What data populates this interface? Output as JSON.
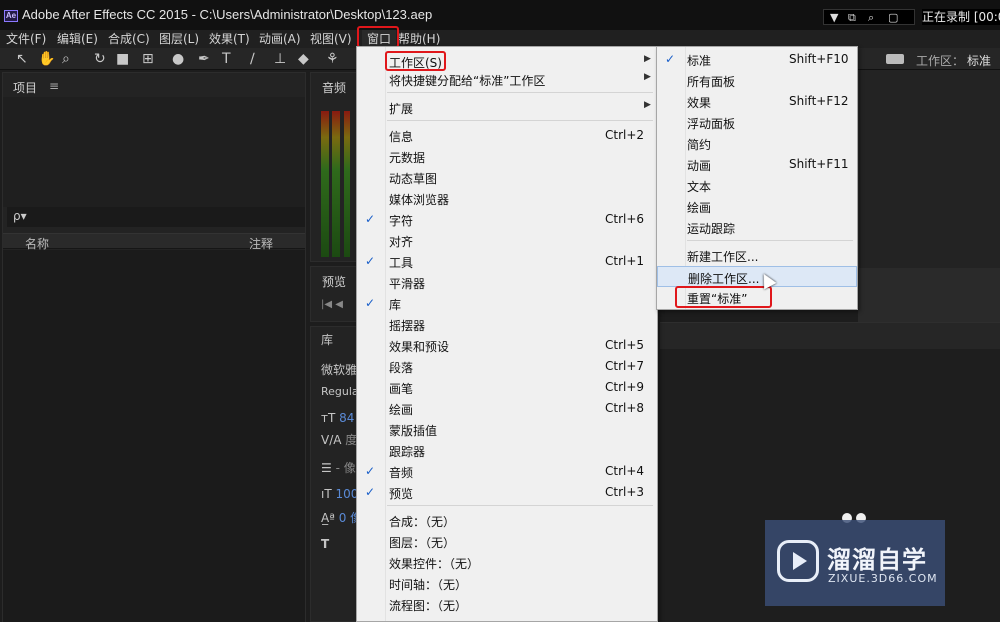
{
  "app": {
    "logo": "Ae",
    "title": "Adobe After Effects CC 2015 - C:\\Users\\Administrator\\Desktop\\123.aep",
    "recording_status": "正在录制 [00:04"
  },
  "menubar": {
    "items": [
      "文件(F)",
      "编辑(E)",
      "合成(C)",
      "图层(L)",
      "效果(T)",
      "动画(A)",
      "视图(V)",
      "窗口",
      "帮助(H)"
    ]
  },
  "toolbar": {
    "workspace_label": "工作区：",
    "workspace_value": "标准"
  },
  "panels": {
    "project_title": "项目",
    "project_menu_icon": "≡",
    "search_icon": "ρ▾",
    "col_name": "名称",
    "col_note": "注释",
    "audio_title": "音频",
    "preview_title": "预览",
    "library_title": "库",
    "char_font": "微软雅",
    "char_style": "Regula",
    "char_size": "84",
    "char_tracking": "度",
    "char_line": "- 像",
    "char_scale": "100",
    "char_baseline": "0 像"
  },
  "window_menu": {
    "items": [
      {
        "label": "工作区(S)",
        "shortcut": "",
        "checked": false,
        "submenu": true
      },
      {
        "label": "将快捷键分配给“标准”工作区",
        "shortcut": "",
        "checked": false,
        "submenu": true
      },
      {
        "label": "扩展",
        "shortcut": "",
        "checked": false,
        "submenu": true
      },
      {
        "label": "信息",
        "shortcut": "Ctrl+2",
        "checked": false
      },
      {
        "label": "元数据",
        "shortcut": "",
        "checked": false
      },
      {
        "label": "动态草图",
        "shortcut": "",
        "checked": false
      },
      {
        "label": "媒体浏览器",
        "shortcut": "",
        "checked": false
      },
      {
        "label": "字符",
        "shortcut": "Ctrl+6",
        "checked": true
      },
      {
        "label": "对齐",
        "shortcut": "",
        "checked": false
      },
      {
        "label": "工具",
        "shortcut": "Ctrl+1",
        "checked": true
      },
      {
        "label": "平滑器",
        "shortcut": "",
        "checked": false
      },
      {
        "label": "库",
        "shortcut": "",
        "checked": true
      },
      {
        "label": "摇摆器",
        "shortcut": "",
        "checked": false
      },
      {
        "label": "效果和预设",
        "shortcut": "Ctrl+5",
        "checked": false
      },
      {
        "label": "段落",
        "shortcut": "Ctrl+7",
        "checked": false
      },
      {
        "label": "画笔",
        "shortcut": "Ctrl+9",
        "checked": false
      },
      {
        "label": "绘画",
        "shortcut": "Ctrl+8",
        "checked": false
      },
      {
        "label": "蒙版插值",
        "shortcut": "",
        "checked": false
      },
      {
        "label": "跟踪器",
        "shortcut": "",
        "checked": false
      },
      {
        "label": "音频",
        "shortcut": "Ctrl+4",
        "checked": true
      },
      {
        "label": "预览",
        "shortcut": "Ctrl+3",
        "checked": true
      },
      {
        "label": "合成：（无）",
        "shortcut": "",
        "checked": false
      },
      {
        "label": "图层：（无）",
        "shortcut": "",
        "checked": false
      },
      {
        "label": "效果控件：（无）",
        "shortcut": "",
        "checked": false
      },
      {
        "label": "时间轴：（无）",
        "shortcut": "",
        "checked": false
      },
      {
        "label": "流程图：（无）",
        "shortcut": "",
        "checked": false
      }
    ]
  },
  "workspace_submenu": {
    "items": [
      {
        "label": "标准",
        "shortcut": "Shift+F10",
        "checked": true
      },
      {
        "label": "所有面板",
        "shortcut": "",
        "checked": false
      },
      {
        "label": "效果",
        "shortcut": "Shift+F12",
        "checked": false
      },
      {
        "label": "浮动面板",
        "shortcut": "",
        "checked": false
      },
      {
        "label": "简约",
        "shortcut": "",
        "checked": false
      },
      {
        "label": "动画",
        "shortcut": "Shift+F11",
        "checked": false
      },
      {
        "label": "文本",
        "shortcut": "",
        "checked": false
      },
      {
        "label": "绘画",
        "shortcut": "",
        "checked": false
      },
      {
        "label": "运动跟踪",
        "shortcut": "",
        "checked": false
      },
      {
        "label": "新建工作区...",
        "shortcut": "",
        "checked": false
      },
      {
        "label": "删除工作区...",
        "shortcut": "",
        "checked": false
      },
      {
        "label": "重置“标准”",
        "shortcut": "",
        "checked": false
      }
    ]
  },
  "watermark": {
    "name": "溜溜自学",
    "url": "ZIXUE.3D66.COM"
  },
  "colors": {
    "highlight_box": "#e0171b",
    "check": "#1a5fc9",
    "menu_bg": "#f0f0f0"
  }
}
